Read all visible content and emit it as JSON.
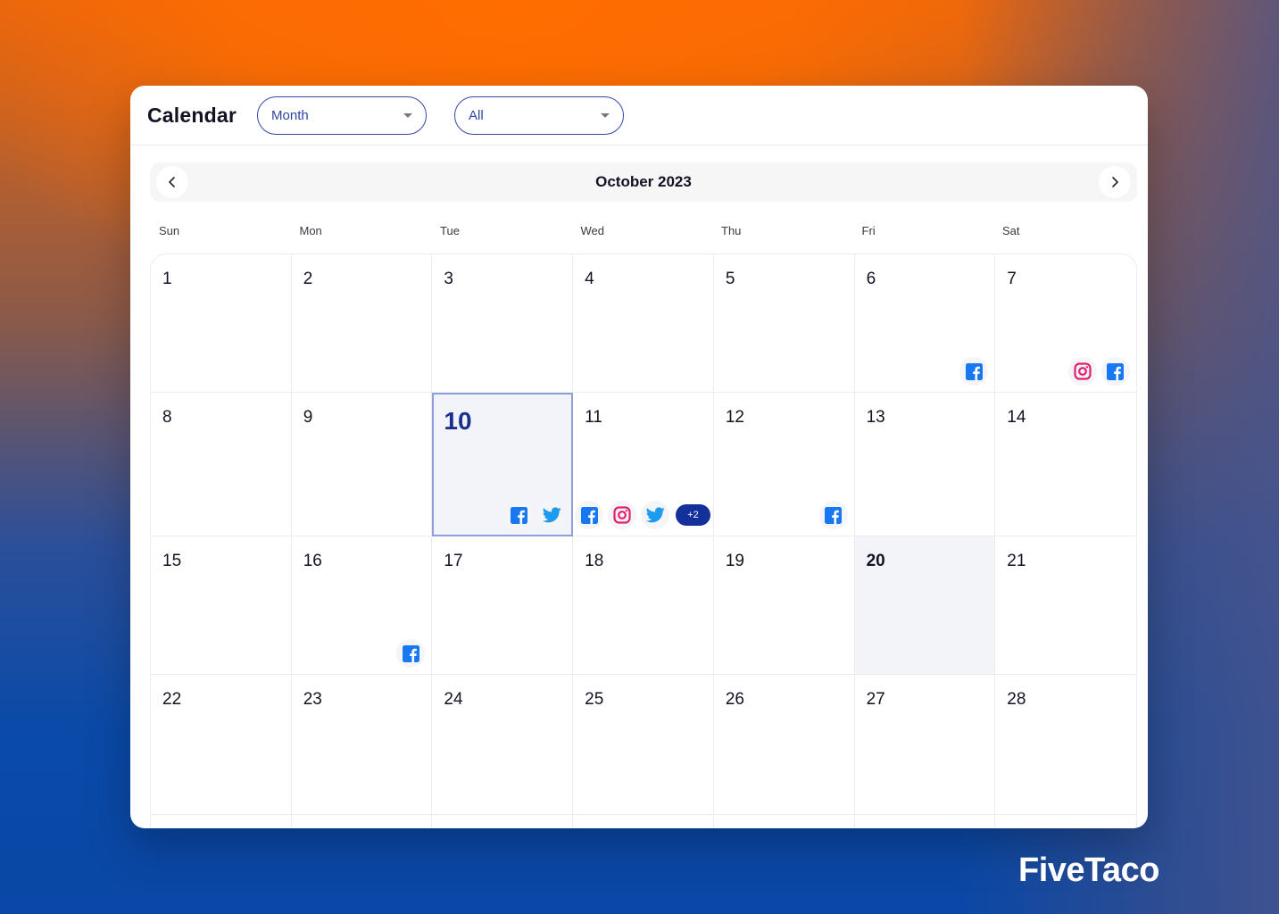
{
  "header": {
    "title": "Calendar",
    "view_select": {
      "value": "Month"
    },
    "filter_select": {
      "value": "All"
    }
  },
  "navigation": {
    "month_label": "October 2023",
    "prev_icon": "chevron-left-icon",
    "next_icon": "chevron-right-icon"
  },
  "weekdays": [
    "Sun",
    "Mon",
    "Tue",
    "Wed",
    "Thu",
    "Fri",
    "Sat"
  ],
  "days": [
    {
      "day": "1",
      "events": []
    },
    {
      "day": "2",
      "events": []
    },
    {
      "day": "3",
      "events": []
    },
    {
      "day": "4",
      "events": []
    },
    {
      "day": "5",
      "events": []
    },
    {
      "day": "6",
      "events": [
        "facebook"
      ]
    },
    {
      "day": "7",
      "events": [
        "instagram",
        "facebook"
      ]
    },
    {
      "day": "8",
      "events": []
    },
    {
      "day": "9",
      "events": []
    },
    {
      "day": "10",
      "events": [
        "facebook",
        "twitter"
      ],
      "selected": true
    },
    {
      "day": "11",
      "events": [
        "facebook",
        "instagram",
        "twitter"
      ],
      "more": "+2"
    },
    {
      "day": "12",
      "events": [
        "facebook"
      ]
    },
    {
      "day": "13",
      "events": []
    },
    {
      "day": "14",
      "events": []
    },
    {
      "day": "15",
      "events": []
    },
    {
      "day": "16",
      "events": [
        "facebook"
      ]
    },
    {
      "day": "17",
      "events": []
    },
    {
      "day": "18",
      "events": []
    },
    {
      "day": "19",
      "events": []
    },
    {
      "day": "20",
      "events": [],
      "today": true
    },
    {
      "day": "21",
      "events": []
    },
    {
      "day": "22",
      "events": []
    },
    {
      "day": "23",
      "events": []
    },
    {
      "day": "24",
      "events": []
    },
    {
      "day": "25",
      "events": []
    },
    {
      "day": "26",
      "events": []
    },
    {
      "day": "27",
      "events": []
    },
    {
      "day": "28",
      "events": []
    },
    {
      "day": "",
      "events": []
    },
    {
      "day": "",
      "events": []
    },
    {
      "day": "",
      "events": []
    },
    {
      "day": "",
      "events": []
    },
    {
      "day": "",
      "events": []
    },
    {
      "day": "",
      "events": []
    },
    {
      "day": "",
      "events": []
    }
  ],
  "colors": {
    "facebook": "#1877f2",
    "instagram": "#e4206e",
    "twitter": "#1d9bf0",
    "accent": "#14309a",
    "selected_border": "#8da0db"
  },
  "brand": {
    "name": "FiveTaco"
  }
}
